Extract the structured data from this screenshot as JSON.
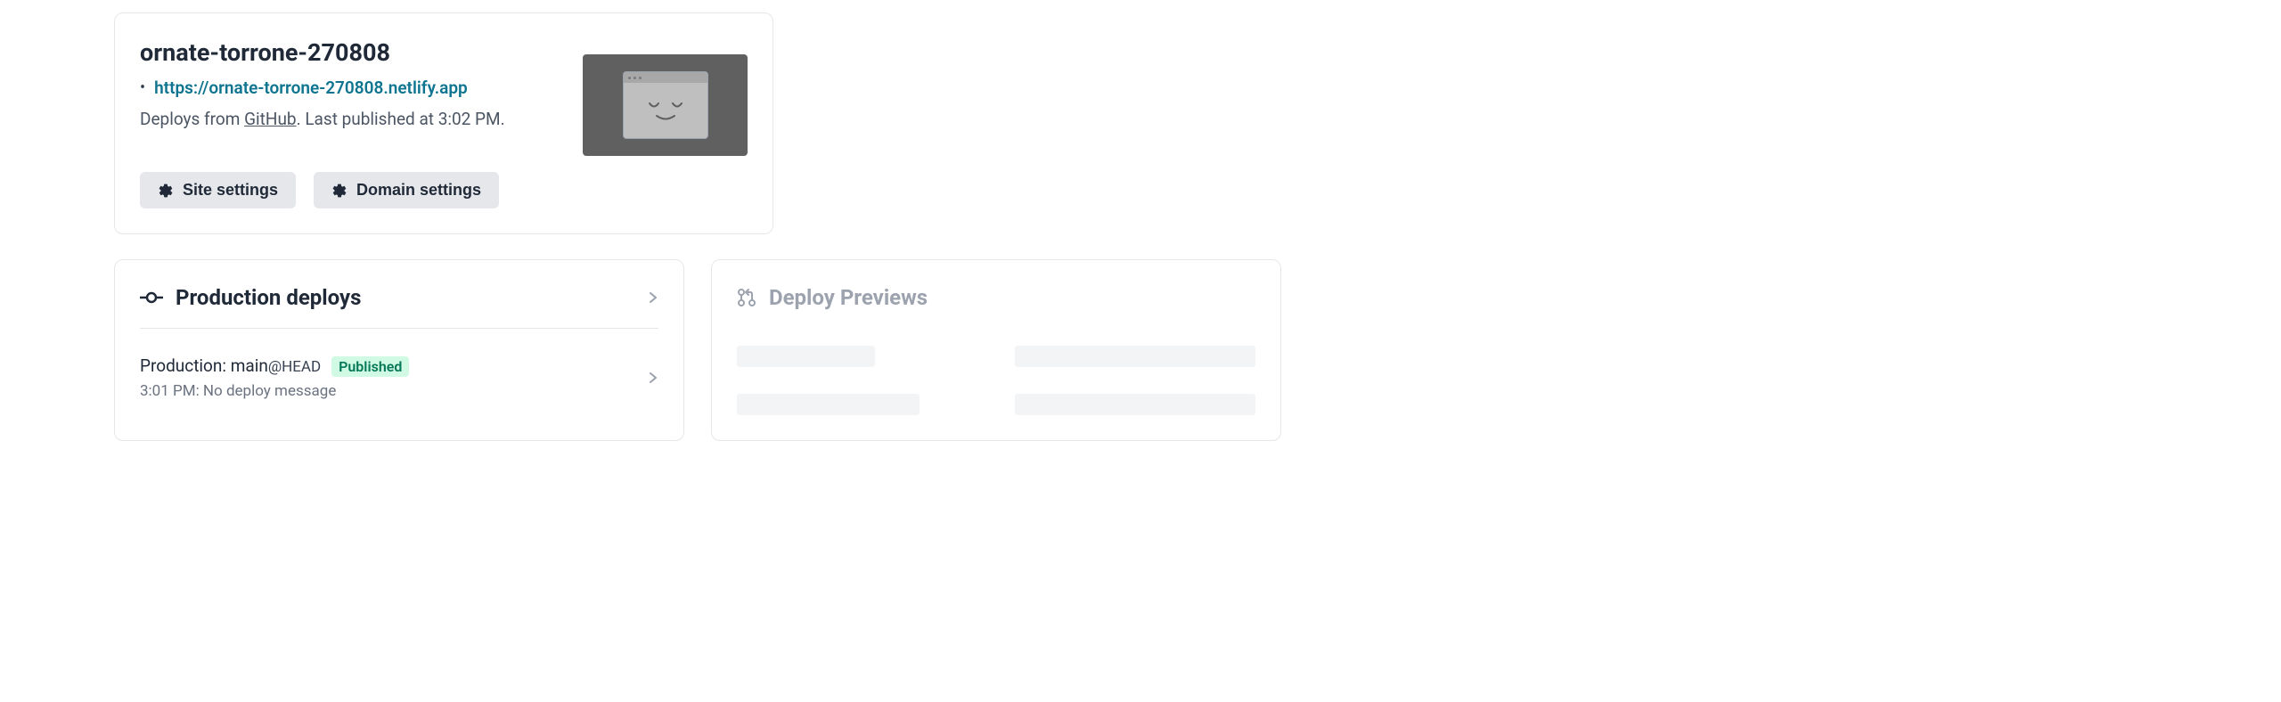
{
  "site": {
    "name": "ornate-torrone-270808",
    "url": "https://ornate-torrone-270808.netlify.app",
    "deploy_source_prefix": "Deploys from ",
    "deploy_source_link": "GitHub",
    "deploy_published_suffix": ". Last published at 3:02 PM."
  },
  "buttons": {
    "site_settings": "Site settings",
    "domain_settings": "Domain settings"
  },
  "production_deploys": {
    "title": "Production deploys",
    "items": [
      {
        "label": "Production: ",
        "branch": "main",
        "ref": "@HEAD",
        "status": "Published",
        "time": "3:01 PM: ",
        "message": "No deploy message"
      }
    ]
  },
  "deploy_previews": {
    "title": "Deploy Previews"
  }
}
